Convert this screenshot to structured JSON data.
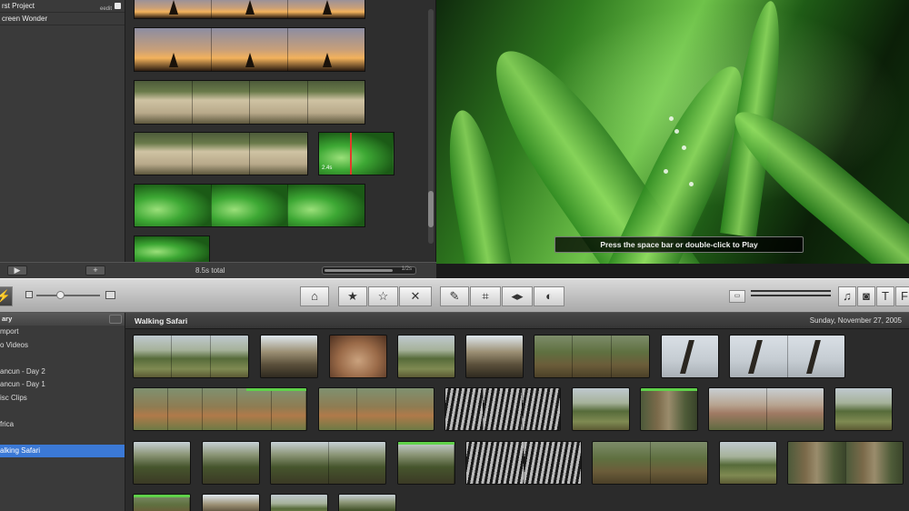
{
  "projects": {
    "items": [
      {
        "label": "rst Project",
        "badge": "eedit",
        "has_dot": true
      },
      {
        "label": "creen Wonder",
        "badge": "",
        "has_dot": false
      }
    ]
  },
  "project_bar": {
    "total_label": "8.5s total",
    "zoom_label": "1/2s"
  },
  "project_clips": [
    {
      "kind": "sunset",
      "frames": 3,
      "timecode": ""
    },
    {
      "kind": "sunset",
      "frames": 3,
      "timecode": ""
    },
    {
      "kind": "sheep",
      "frames": 4,
      "timecode": ""
    },
    {
      "kind": "sheep",
      "frames": 3,
      "timecode": ""
    },
    {
      "kind": "grass",
      "frames": 1,
      "timecode": "2.4s"
    },
    {
      "kind": "grass",
      "frames": 3,
      "timecode": ""
    },
    {
      "kind": "grass",
      "frames": 1,
      "timecode": ""
    }
  ],
  "viewer": {
    "hint": "Press the space bar or double-click to Play"
  },
  "toolbar": {
    "buttons": [
      {
        "icon": "reject-icon",
        "glyph": "⌂"
      },
      {
        "icon": "favorite-star-icon",
        "glyph": "★"
      },
      {
        "icon": "unmark-star-icon",
        "glyph": "☆"
      },
      {
        "icon": "reject-x-icon",
        "glyph": "✕"
      },
      {
        "icon": "dropper-icon",
        "glyph": "✎"
      },
      {
        "icon": "crop-icon",
        "glyph": "⌗"
      },
      {
        "icon": "audio-icon",
        "glyph": "◂▸"
      },
      {
        "icon": "inspector-icon",
        "glyph": "◐"
      },
      {
        "icon": "music-icon",
        "glyph": "♫"
      },
      {
        "icon": "camera-icon",
        "glyph": "◙"
      },
      {
        "icon": "title-icon",
        "glyph": "T"
      },
      {
        "icon": "transitions-icon",
        "glyph": "F"
      }
    ]
  },
  "library": {
    "header": "ary",
    "items": [
      "mport",
      "o Videos",
      "",
      "ancun - Day 2",
      "ancun - Day 1",
      "isc Clips",
      "",
      "frica",
      "",
      "alking Safari"
    ],
    "selected_index": 9
  },
  "event": {
    "title": "Walking Safari",
    "date": "Sunday, November 27, 2005"
  },
  "event_clips": [
    {
      "kind": "savanna",
      "frames": 3,
      "used": 0
    },
    {
      "kind": "hut",
      "frames": 1,
      "used": 0
    },
    {
      "kind": "basket",
      "frames": 1,
      "used": 0
    },
    {
      "kind": "savanna",
      "frames": 1,
      "used": 0
    },
    {
      "kind": "hut",
      "frames": 1,
      "used": 0
    },
    {
      "kind": "bush",
      "frames": 3,
      "used": 0
    },
    {
      "kind": "giraffe",
      "frames": 1,
      "used": 0
    },
    {
      "kind": "giraffe",
      "frames": 2,
      "used": 0
    },
    {
      "kind": "impala",
      "frames": 5,
      "used": 0.35
    },
    {
      "kind": "impala",
      "frames": 3,
      "used": 0
    },
    {
      "kind": "zebra",
      "frames": 3,
      "used": 0
    },
    {
      "kind": "savanna",
      "frames": 1,
      "used": 0
    },
    {
      "kind": "trunk",
      "frames": 1,
      "used": 1
    },
    {
      "kind": "pink",
      "frames": 2,
      "used": 0
    },
    {
      "kind": "savanna",
      "frames": 1,
      "used": 0
    },
    {
      "kind": "forest",
      "frames": 1,
      "used": 0
    },
    {
      "kind": "forest",
      "frames": 1,
      "used": 0
    },
    {
      "kind": "forest",
      "frames": 2,
      "used": 0
    },
    {
      "kind": "forest",
      "frames": 1,
      "used": 1
    },
    {
      "kind": "zebra",
      "frames": 2,
      "used": 0
    },
    {
      "kind": "bush",
      "frames": 2,
      "used": 0
    },
    {
      "kind": "savanna",
      "frames": 1,
      "used": 0
    },
    {
      "kind": "trunk",
      "frames": 2,
      "used": 0
    },
    {
      "kind": "bush",
      "frames": 1,
      "used": 1
    },
    {
      "kind": "hut",
      "frames": 1,
      "used": 0
    },
    {
      "kind": "savanna",
      "frames": 1,
      "used": 0
    },
    {
      "kind": "forest",
      "frames": 1,
      "used": 0
    }
  ]
}
